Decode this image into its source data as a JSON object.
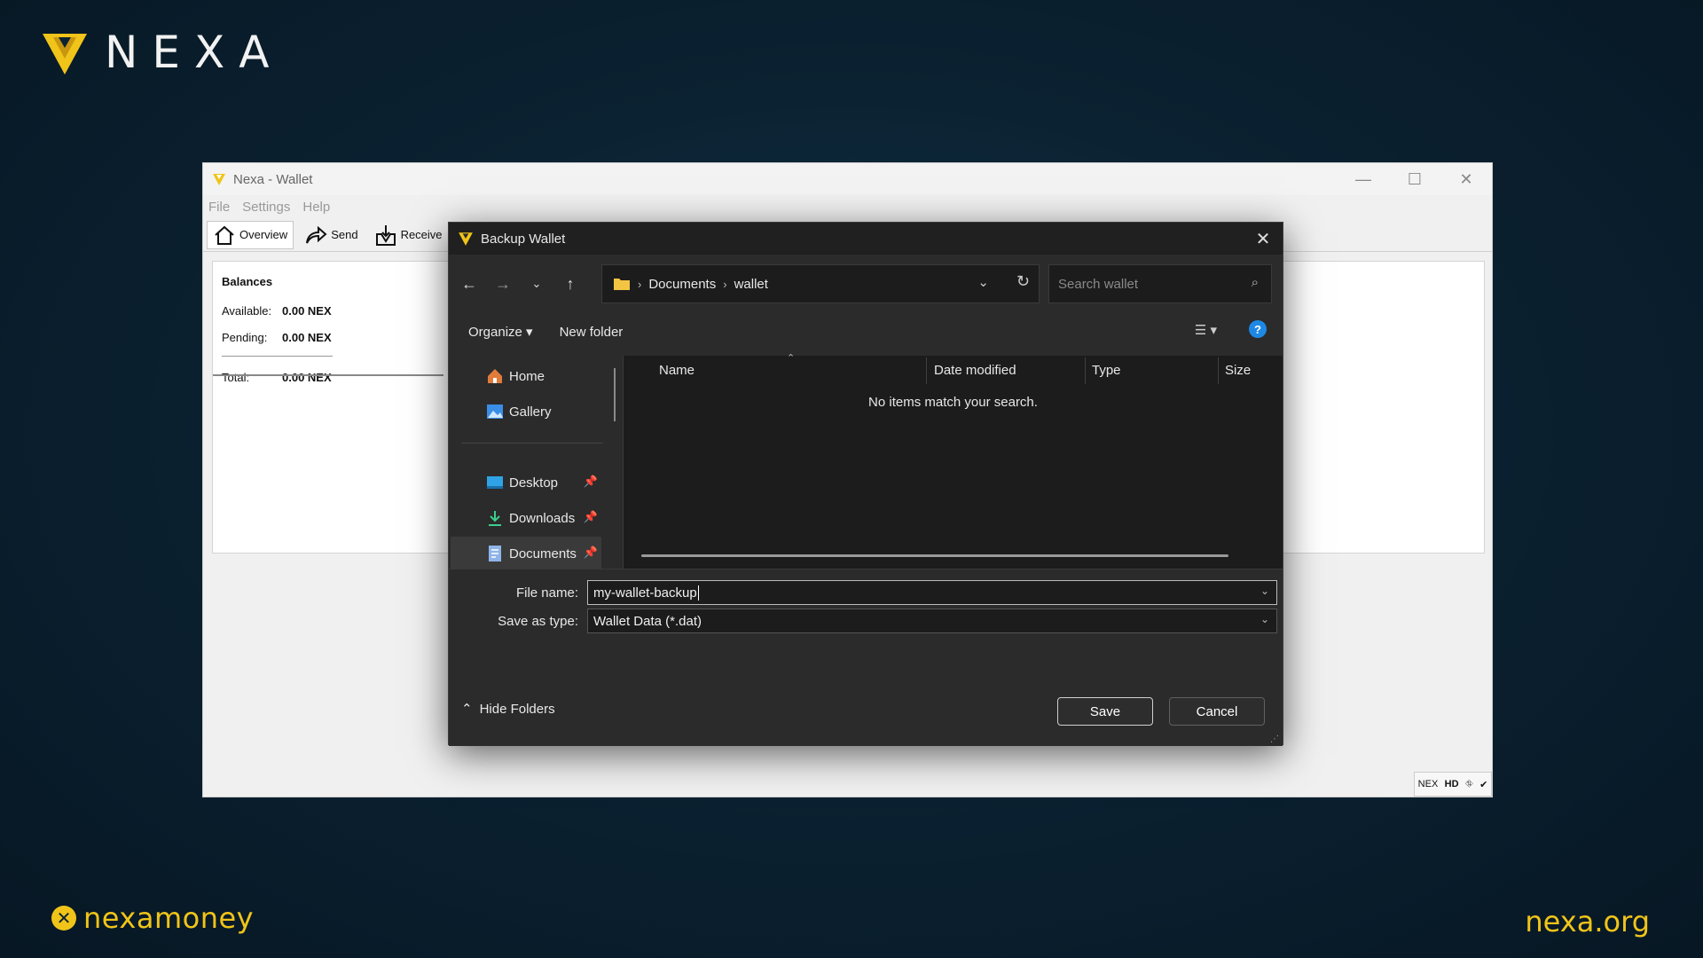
{
  "brand": {
    "logo_text": "NEXA",
    "footer_left": "nexamoney",
    "footer_right": "nexa.org",
    "accent": "#f0c419"
  },
  "wallet": {
    "title": "Nexa - Wallet",
    "menu": [
      "File",
      "Settings",
      "Help"
    ],
    "toolbar": [
      {
        "label": "Overview",
        "icon": "home-icon",
        "active": true
      },
      {
        "label": "Send",
        "icon": "send-arrow-icon"
      },
      {
        "label": "Receive",
        "icon": "receive-icon"
      }
    ],
    "balances": {
      "heading": "Balances",
      "available_label": "Available:",
      "available_value": "0.00 NEX",
      "pending_label": "Pending:",
      "pending_value": "0.00 NEX",
      "total_label": "Total:",
      "total_value": "0.00 NEX"
    },
    "status": {
      "unit": "NEX",
      "hd": "HD"
    }
  },
  "dialog": {
    "title": "Backup Wallet",
    "path": [
      "Documents",
      "wallet"
    ],
    "search_placeholder": "Search wallet",
    "commands": {
      "organize": "Organize",
      "new_folder": "New folder"
    },
    "nav": {
      "home": "Home",
      "gallery": "Gallery",
      "desktop": "Desktop",
      "downloads": "Downloads",
      "documents": "Documents",
      "selected": "Documents"
    },
    "columns": {
      "name": "Name",
      "date": "Date modified",
      "type": "Type",
      "size": "Size"
    },
    "empty_message": "No items match your search.",
    "file_name_label": "File name:",
    "file_name_value": "my-wallet-backup",
    "save_type_label": "Save as type:",
    "save_type_value": "Wallet Data (*.dat)",
    "hide_folders": "Hide Folders",
    "save_label": "Save",
    "cancel_label": "Cancel"
  }
}
